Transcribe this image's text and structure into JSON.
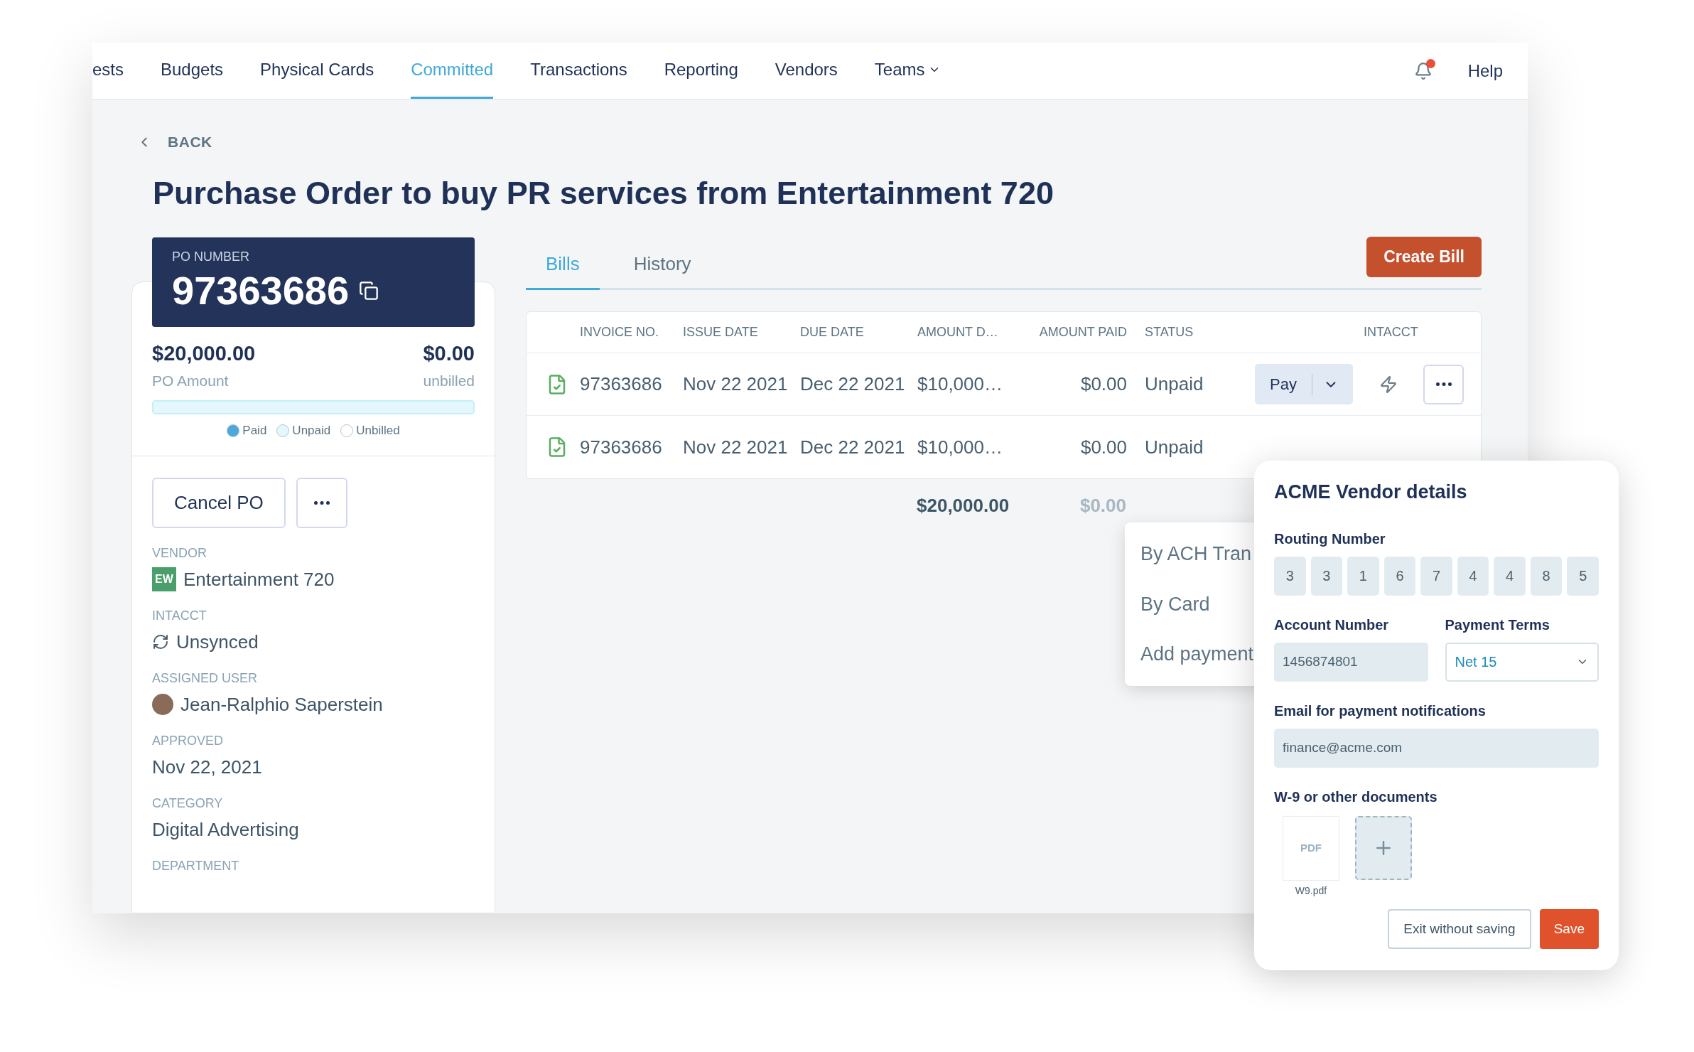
{
  "nav": {
    "items": [
      {
        "label": "ests",
        "selected": false,
        "dropdown": false
      },
      {
        "label": "Budgets",
        "selected": false,
        "dropdown": false
      },
      {
        "label": "Physical Cards",
        "selected": false,
        "dropdown": false
      },
      {
        "label": "Committed",
        "selected": true,
        "dropdown": false
      },
      {
        "label": "Transactions",
        "selected": false,
        "dropdown": false
      },
      {
        "label": "Reporting",
        "selected": false,
        "dropdown": false
      },
      {
        "label": "Vendors",
        "selected": false,
        "dropdown": false
      },
      {
        "label": "Teams",
        "selected": false,
        "dropdown": true
      }
    ],
    "notifications_unread": true,
    "help": "Help"
  },
  "back": "BACK",
  "title": "Purchase Order to buy PR services from Entertainment 720",
  "po": {
    "label": "PO NUMBER",
    "number": "97363686",
    "amount": "$20,000.00",
    "amount_label": "PO Amount",
    "unbilled": "$0.00",
    "unbilled_label": "unbilled",
    "bar": {
      "level": 0
    },
    "legend": [
      {
        "label": "Paid",
        "color": "#4aa8dd"
      },
      {
        "label": "Unpaid",
        "color": "#e4f7fc"
      },
      {
        "label": "Unbilled",
        "color": "#ffffff"
      }
    ],
    "cancel": "Cancel PO"
  },
  "details": [
    {
      "kind": "vendor",
      "label": "VENDOR",
      "badge": "EW",
      "value": "Entertainment 720"
    },
    {
      "kind": "sync",
      "label": "INTACCT",
      "value": "Unsynced"
    },
    {
      "kind": "user",
      "label": "ASSIGNED USER",
      "value": "Jean-Ralphio Saperstein"
    },
    {
      "kind": "text",
      "label": "APPROVED",
      "value": "Nov 22, 2021"
    },
    {
      "kind": "text",
      "label": "CATEGORY",
      "value": "Digital Advertising"
    },
    {
      "kind": "text",
      "label": "DEPARTMENT"
    }
  ],
  "tabs": [
    {
      "label": "Bills",
      "selected": true
    },
    {
      "label": "History",
      "selected": false
    }
  ],
  "create_bill": "Create Bill",
  "table": {
    "columns": [
      "INVOICE NO.",
      "ISSUE DATE",
      "DUE DATE",
      "AMOUNT D…",
      "AMOUNT PAID",
      "STATUS",
      "INTACCT"
    ],
    "rows": [
      {
        "invoice": "97363686",
        "issue_date": "Nov 22 2021",
        "due_date": "Dec 22 2021",
        "amount_due": "$10,000…",
        "amount_paid": "$0.00",
        "status": "Unpaid",
        "pay": "Pay"
      },
      {
        "invoice": "97363686",
        "issue_date": "Nov 22 2021",
        "due_date": "Dec 22 2021",
        "amount_due": "$10,000…",
        "amount_paid": "$0.00",
        "status": "Unpaid"
      }
    ],
    "totals": {
      "amount_due": "$20,000.00",
      "amount_paid": "$0.00"
    }
  },
  "pay_menu": [
    "By ACH Tran",
    "By Card",
    "Add payment"
  ],
  "vendor_panel": {
    "title": "ACME Vendor details",
    "routing_label": "Routing Number",
    "routing_digits": [
      "3",
      "3",
      "1",
      "6",
      "7",
      "4",
      "4",
      "8",
      "5"
    ],
    "account_label": "Account Number",
    "account_value": "1456874801",
    "terms_label": "Payment Terms",
    "terms_value": "Net 15",
    "email_label": "Email for payment notifications",
    "email_value": "finance@acme.com",
    "docs_label": "W-9 or other documents",
    "doc": {
      "type": "PDF",
      "name": "W9.pdf"
    },
    "exit": "Exit without saving",
    "save": "Save"
  }
}
